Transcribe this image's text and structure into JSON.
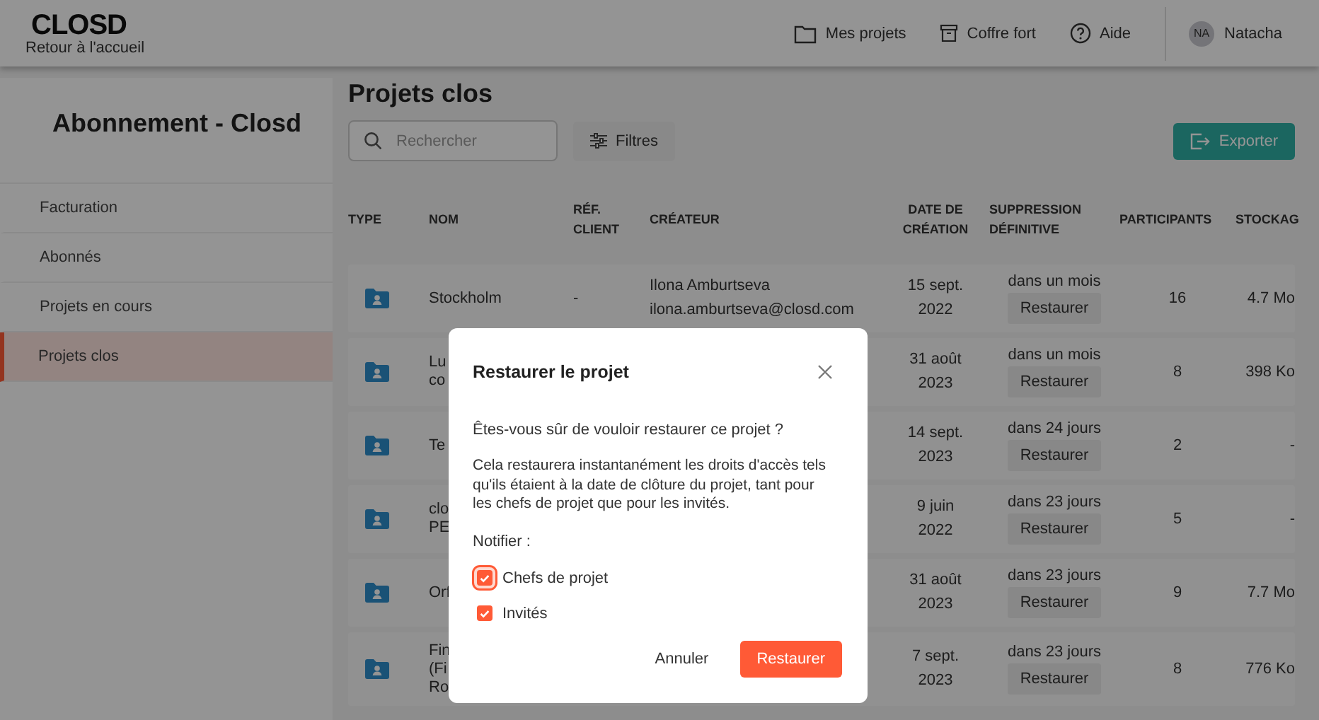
{
  "header": {
    "logo": "CLOSD",
    "back_link": "Retour à l'accueil",
    "nav": [
      {
        "label": "Mes projets"
      },
      {
        "label": "Coffre fort"
      },
      {
        "label": "Aide"
      }
    ],
    "user": {
      "initials": "NA",
      "name": "Natacha"
    }
  },
  "sidebar": {
    "title": "Abonnement - Closd",
    "items": [
      {
        "label": "Facturation",
        "selected": false
      },
      {
        "label": "Abonnés",
        "selected": false
      },
      {
        "label": "Projets en cours",
        "selected": false
      },
      {
        "label": "Projets clos",
        "selected": true
      }
    ]
  },
  "main": {
    "title": "Projets clos",
    "search": {
      "placeholder": "Rechercher"
    },
    "filter_button": "Filtres",
    "export_button": "Exporter"
  },
  "table": {
    "columns": [
      "TYPE",
      "NOM",
      "RÉF.\nCLIENT",
      "CRÉATEUR",
      "DATE DE\nCRÉATION",
      "SUPPRESSION\nDÉFINITIVE",
      "PARTICIPANTS",
      "STOCKAG"
    ],
    "rows": [
      {
        "name": [
          "Stockholm"
        ],
        "ref": "-",
        "creator": [
          "Ilona Amburtseva",
          "ilona.amburtseva@closd.com"
        ],
        "date": [
          "15 sept.",
          "2022"
        ],
        "deletion": "dans un mois",
        "restore": "Restaurer",
        "participants": "16",
        "storage": "4.7 Mo"
      },
      {
        "name": [
          "Lu",
          "co"
        ],
        "date": [
          "31 août",
          "2023"
        ],
        "deletion": "dans un mois",
        "restore": "Restaurer",
        "participants": "8",
        "storage": "398 Ko"
      },
      {
        "name": [
          "Te"
        ],
        "date": [
          "14 sept.",
          "2023"
        ],
        "deletion": "dans 24 jours",
        "restore": "Restaurer",
        "participants": "2",
        "storage": "-"
      },
      {
        "name": [
          "clo",
          "PE"
        ],
        "date": [
          "9 juin",
          "2022"
        ],
        "deletion": "dans 23 jours",
        "restore": "Restaurer",
        "participants": "5",
        "storage": "-"
      },
      {
        "name": [
          "Orf"
        ],
        "date": [
          "31 août",
          "2023"
        ],
        "deletion": "dans 23 jours",
        "restore": "Restaurer",
        "participants": "9",
        "storage": "7.7 Mo"
      },
      {
        "name": [
          "Fin",
          "(Fi",
          "Ro"
        ],
        "date": [
          "7 sept.",
          "2023"
        ],
        "deletion": "dans 23 jours",
        "restore": "Restaurer",
        "participants": "8",
        "storage": "776 Ko"
      }
    ]
  },
  "dialog": {
    "title": "Restaurer le projet",
    "question": "Êtes-vous sûr de vouloir restaurer ce projet ?",
    "message": "Cela restaurera instantanément les droits d'accès tels qu'ils étaient à la date de clôture du projet, tant pour les chefs de projet que pour les invités.",
    "notify_label": "Notifier :",
    "options": [
      {
        "label": "Chefs de projet",
        "checked": true,
        "focused": true
      },
      {
        "label": "Invités",
        "checked": true,
        "focused": false
      }
    ],
    "cancel": "Annuler",
    "confirm": "Restaurer"
  }
}
